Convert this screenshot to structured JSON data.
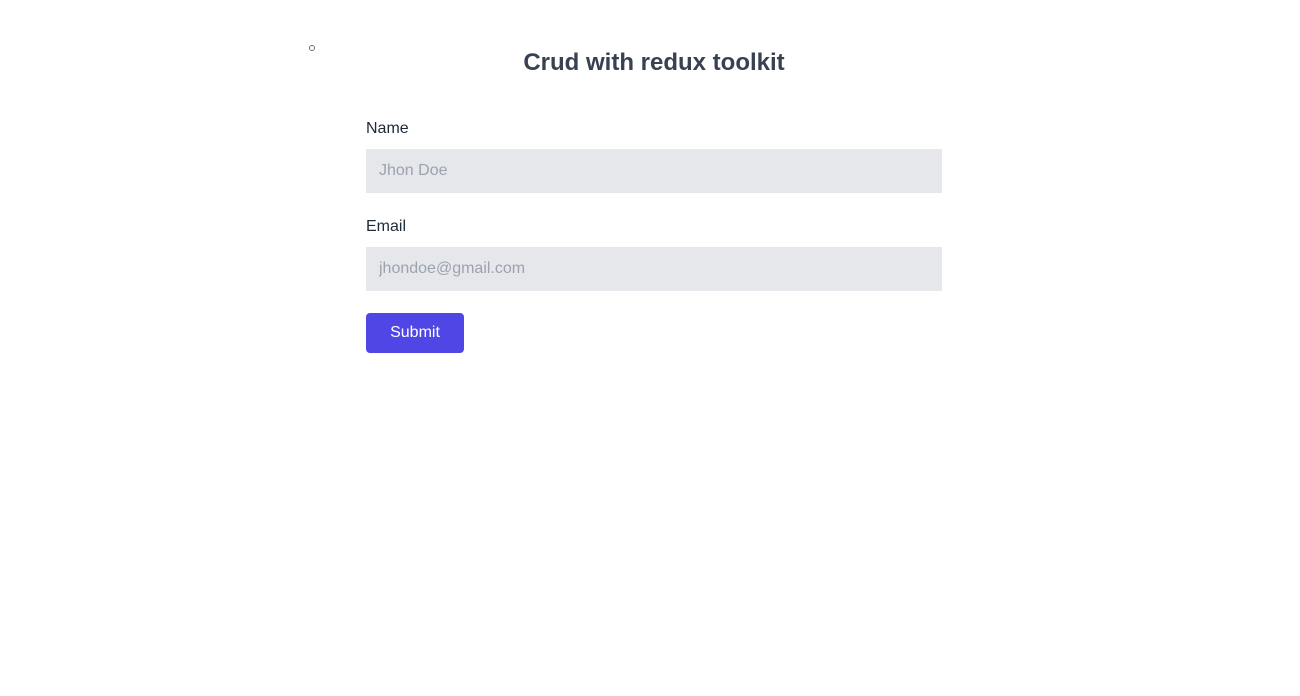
{
  "page": {
    "title": "Crud with redux toolkit"
  },
  "form": {
    "name": {
      "label": "Name",
      "placeholder": "Jhon Doe",
      "value": ""
    },
    "email": {
      "label": "Email",
      "placeholder": "jhondoe@gmail.com",
      "value": ""
    },
    "submit_label": "Submit"
  },
  "colors": {
    "accent": "#4f46e5",
    "input_background": "#e5e7eb",
    "title": "#374151"
  }
}
